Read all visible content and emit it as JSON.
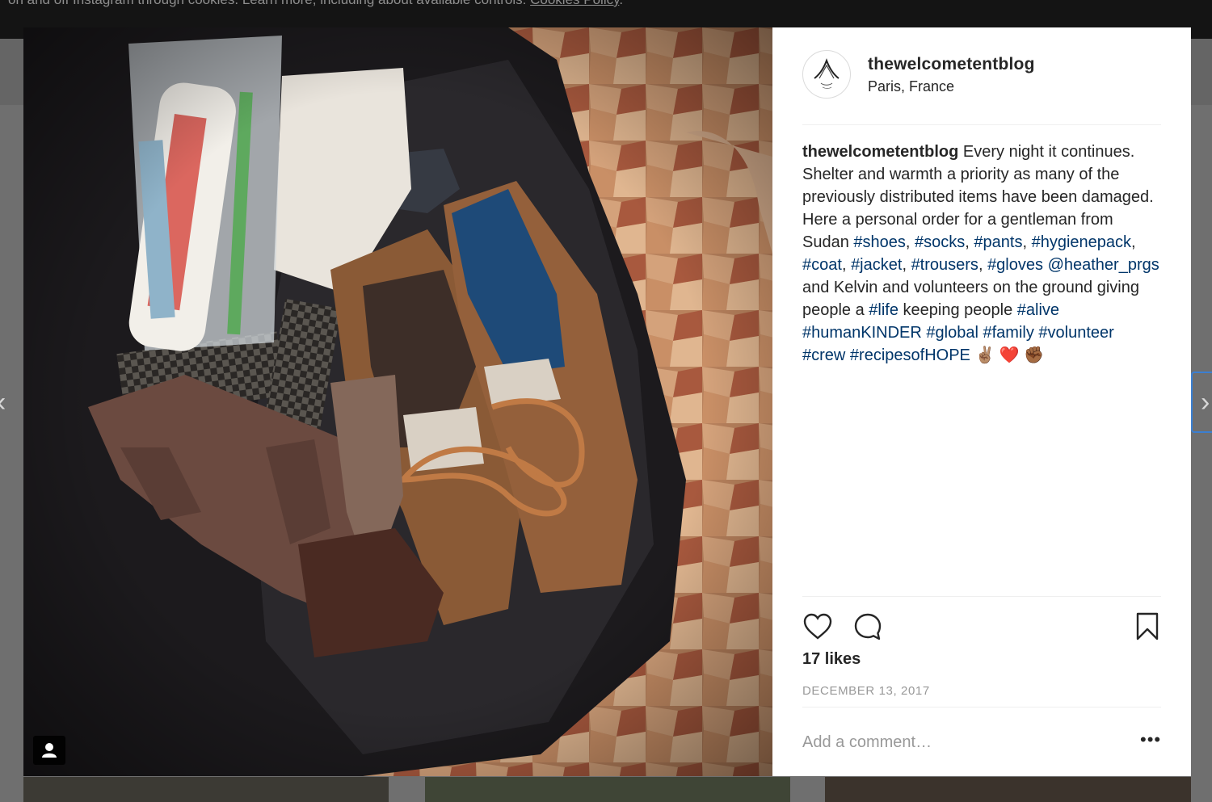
{
  "cookie_bar": {
    "text": "on and off Instagram through cookies. Learn more, including about available controls:",
    "link": "Cookies Policy",
    "suffix": "."
  },
  "nav": {
    "prev_glyph": "‹",
    "next_glyph": "›"
  },
  "post": {
    "username": "thewelcometentblog",
    "location": "Paris, France",
    "caption_segments": [
      {
        "text": "thewelcometentblog",
        "type": "user"
      },
      {
        "text": " Every night it continues. Shelter and warmth a priority as many of the previously distributed items have been damaged. Here a personal order for a gentleman from Sudan ",
        "type": "text"
      },
      {
        "text": "#shoes",
        "type": "link"
      },
      {
        "text": ", ",
        "type": "text"
      },
      {
        "text": "#socks",
        "type": "link"
      },
      {
        "text": ", ",
        "type": "text"
      },
      {
        "text": "#pants",
        "type": "link"
      },
      {
        "text": ", ",
        "type": "text"
      },
      {
        "text": "#hygienepack",
        "type": "link"
      },
      {
        "text": ", ",
        "type": "text"
      },
      {
        "text": "#coat",
        "type": "link"
      },
      {
        "text": ", ",
        "type": "text"
      },
      {
        "text": "#jacket",
        "type": "link"
      },
      {
        "text": ", ",
        "type": "text"
      },
      {
        "text": "#trousers",
        "type": "link"
      },
      {
        "text": ", ",
        "type": "text"
      },
      {
        "text": "#gloves",
        "type": "link"
      },
      {
        "text": " ",
        "type": "text"
      },
      {
        "text": "@heather_prgs",
        "type": "link"
      },
      {
        "text": " and Kelvin and volunteers on the ground giving people a ",
        "type": "text"
      },
      {
        "text": "#life",
        "type": "link"
      },
      {
        "text": " keeping people ",
        "type": "text"
      },
      {
        "text": "#alive",
        "type": "link"
      },
      {
        "text": " ",
        "type": "text"
      },
      {
        "text": "#humanKINDER",
        "type": "link"
      },
      {
        "text": " ",
        "type": "text"
      },
      {
        "text": "#global",
        "type": "link"
      },
      {
        "text": " ",
        "type": "text"
      },
      {
        "text": "#family",
        "type": "link"
      },
      {
        "text": " ",
        "type": "text"
      },
      {
        "text": "#volunteer",
        "type": "link"
      },
      {
        "text": " ",
        "type": "text"
      },
      {
        "text": "#crew",
        "type": "link"
      },
      {
        "text": " ",
        "type": "text"
      },
      {
        "text": "#recipesofHOPE",
        "type": "link"
      },
      {
        "text": " ✌🏽 ❤️ ✊🏾",
        "type": "text"
      }
    ],
    "likes": "17 likes",
    "date": "DECEMBER 13, 2017",
    "comment_placeholder": "Add a comment…",
    "more_glyph": "•••"
  },
  "icons": [
    "heart-icon",
    "comment-icon",
    "bookmark-icon",
    "user-tag-icon",
    "ellipsis-icon"
  ],
  "colors": {
    "link": "#003569",
    "text": "#262626",
    "muted": "#999999",
    "divider": "#efefef"
  }
}
